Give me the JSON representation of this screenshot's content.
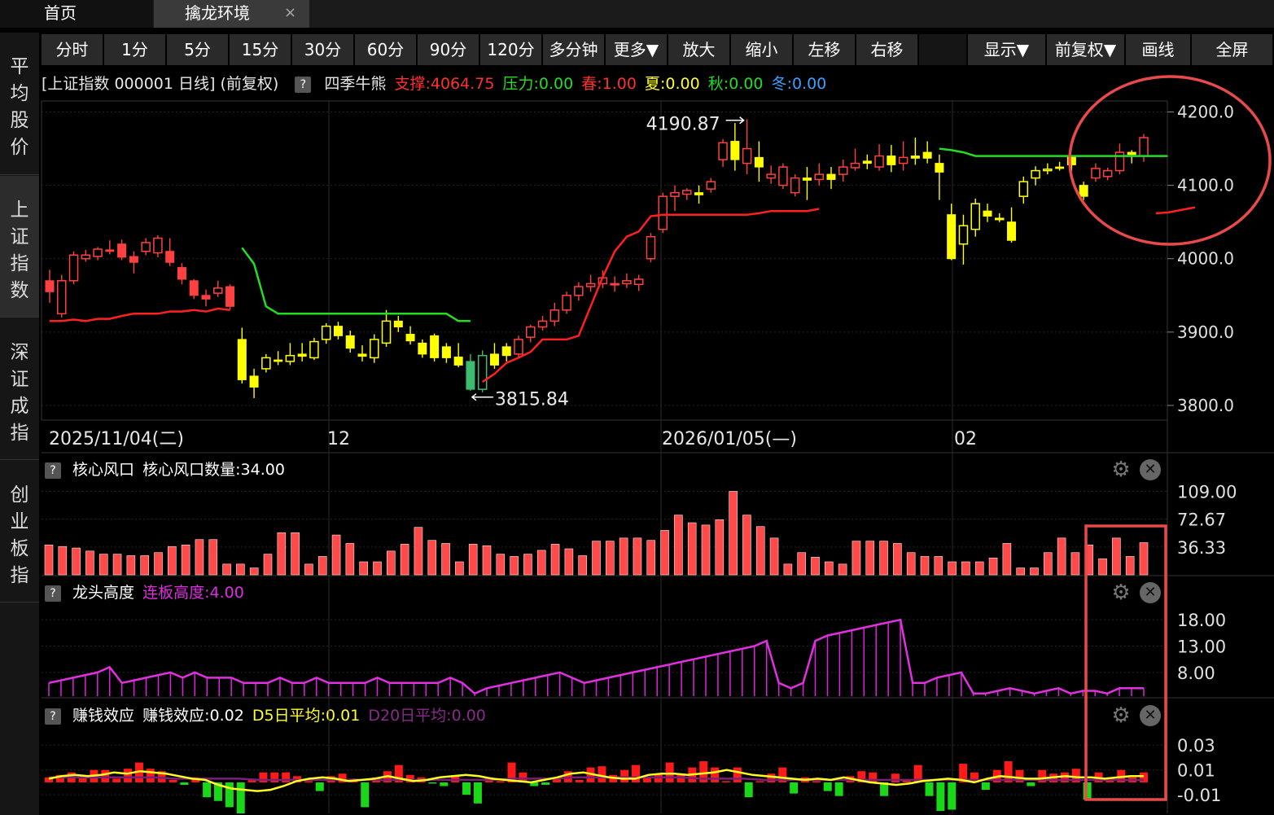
{
  "tabs": {
    "home": "首页",
    "active": "擒龙环境",
    "close": "×"
  },
  "sidebar": [
    {
      "label": "平均股价",
      "active": false
    },
    {
      "label": "上证指数",
      "active": true
    },
    {
      "label": "深证成指",
      "active": false
    },
    {
      "label": "创业板指",
      "active": false
    }
  ],
  "toolbar": [
    "分时",
    "1分",
    "5分",
    "15分",
    "30分",
    "60分",
    "90分",
    "120分",
    "多分钟",
    "更多▼",
    "放大",
    "缩小",
    "左移",
    "右移",
    "",
    "显示▼",
    "前复权▼",
    "画线",
    "全屏"
  ],
  "info": {
    "title": "[上证指数 000001 日线]  (前复权)",
    "help": "?",
    "indicator": "四季牛熊",
    "support": "支撑:4064.75",
    "pressure": "压力:0.00",
    "spring": "春:1.00",
    "summer": "夏:0.00",
    "autumn": "秋:0.00",
    "winter": "冬:0.00"
  },
  "main_axis": [
    "4200.0",
    "4100.0",
    "4000.0",
    "3900.0",
    "3800.0"
  ],
  "annotations": {
    "high": "4190.87",
    "low": "3815.84"
  },
  "date_axis": [
    "2025/11/04(二)",
    "12",
    "2026/01/05(—)",
    "02"
  ],
  "pane1": {
    "help": "?",
    "name": "核心风口",
    "value": "核心风口数量:34.00",
    "axis": [
      "109.00",
      "72.67",
      "36.33"
    ]
  },
  "pane2": {
    "help": "?",
    "name": "龙头高度",
    "value": "连板高度:4.00",
    "axis": [
      "18.00",
      "13.00",
      "8.00"
    ]
  },
  "pane3": {
    "help": "?",
    "name": "赚钱效应",
    "value": "赚钱效应:0.02",
    "d5": "D5日平均:0.01",
    "d20": "D20日平均:0.00",
    "axis": [
      "0.03",
      "0.01",
      "-0.01"
    ]
  },
  "colors": {
    "up": "#ff4040",
    "down_yellow": "#ffff00",
    "green": "#00dd00",
    "magenta": "#dd22dd",
    "annotation_red": "#e84a4a"
  },
  "chart_data": [
    {
      "type": "candlestick",
      "title": "上证指数 000001 日线",
      "y_ticks": [
        4200,
        4100,
        4000,
        3900,
        3800
      ],
      "ylim": [
        3780,
        4215
      ],
      "high_marker": 4190.87,
      "low_marker": 3815.84,
      "candles": [
        [
          3970,
          3955,
          3985,
          3940
        ],
        [
          3925,
          3970,
          3978,
          3920
        ],
        [
          3970,
          4005,
          4010,
          3965
        ],
        [
          4000,
          4005,
          4012,
          3996
        ],
        [
          4003,
          4013,
          4016,
          3998
        ],
        [
          4012,
          4010,
          4025,
          4006
        ],
        [
          4020,
          4002,
          4026,
          3998
        ],
        [
          4003,
          3995,
          4010,
          3980
        ],
        [
          4010,
          4022,
          4028,
          4005
        ],
        [
          4008,
          4028,
          4032,
          4002
        ],
        [
          4010,
          3995,
          4028,
          3990
        ],
        [
          3988,
          3972,
          3994,
          3965
        ],
        [
          3970,
          3950,
          3972,
          3945
        ],
        [
          3950,
          3945,
          3958,
          3935
        ],
        [
          3953,
          3960,
          3970,
          3948
        ],
        [
          3962,
          3935,
          3965,
          3930
        ],
        [
          3890,
          3835,
          3906,
          3830
        ],
        [
          3840,
          3825,
          3850,
          3810
        ],
        [
          3850,
          3865,
          3870,
          3845
        ],
        [
          3862,
          3860,
          3874,
          3855
        ],
        [
          3860,
          3868,
          3885,
          3855
        ],
        [
          3870,
          3867,
          3885,
          3860
        ],
        [
          3865,
          3887,
          3892,
          3862
        ],
        [
          3890,
          3908,
          3912,
          3884
        ],
        [
          3908,
          3895,
          3914,
          3890
        ],
        [
          3895,
          3878,
          3902,
          3872
        ],
        [
          3870,
          3867,
          3882,
          3860
        ],
        [
          3865,
          3890,
          3897,
          3858
        ],
        [
          3885,
          3915,
          3930,
          3880
        ],
        [
          3915,
          3907,
          3922,
          3900
        ],
        [
          3897,
          3888,
          3908,
          3883
        ],
        [
          3885,
          3870,
          3890,
          3865
        ],
        [
          3895,
          3865,
          3898,
          3860
        ],
        [
          3880,
          3865,
          3885,
          3858
        ],
        [
          3866,
          3855,
          3885,
          3852
        ],
        [
          3860,
          3822,
          3870,
          3820
        ],
        [
          3822,
          3868,
          3875,
          3818
        ],
        [
          3870,
          3855,
          3885,
          3850
        ],
        [
          3880,
          3868,
          3885,
          3860
        ],
        [
          3870,
          3890,
          3895,
          3866
        ],
        [
          3893,
          3907,
          3910,
          3886
        ],
        [
          3907,
          3915,
          3922,
          3902
        ],
        [
          3915,
          3930,
          3940,
          3908
        ],
        [
          3930,
          3950,
          3955,
          3925
        ],
        [
          3950,
          3962,
          3968,
          3943
        ],
        [
          3962,
          3966,
          3978,
          3955
        ],
        [
          3966,
          3974,
          3984,
          3960
        ],
        [
          3965,
          3966,
          3976,
          3955
        ],
        [
          3966,
          3970,
          3980,
          3960
        ],
        [
          3965,
          3972,
          3978,
          3956
        ],
        [
          4000,
          4030,
          4035,
          3995
        ],
        [
          4040,
          4085,
          4090,
          4035
        ],
        [
          4085,
          4090,
          4100,
          4065
        ],
        [
          4088,
          4093,
          4096,
          4080
        ],
        [
          4090,
          4087,
          4100,
          4075
        ],
        [
          4095,
          4105,
          4110,
          4090
        ],
        [
          4135,
          4158,
          4163,
          4125
        ],
        [
          4160,
          4135,
          4185,
          4120
        ],
        [
          4130,
          4150,
          4190,
          4115
        ],
        [
          4138,
          4125,
          4160,
          4105
        ],
        [
          4110,
          4115,
          4127,
          4102
        ],
        [
          4100,
          4125,
          4130,
          4095
        ],
        [
          4090,
          4110,
          4115,
          4085
        ],
        [
          4110,
          4107,
          4125,
          4080
        ],
        [
          4108,
          4115,
          4130,
          4100
        ],
        [
          4115,
          4108,
          4125,
          4095
        ],
        [
          4115,
          4125,
          4135,
          4105
        ],
        [
          4124,
          4130,
          4150,
          4120
        ],
        [
          4133,
          4130,
          4142,
          4122
        ],
        [
          4125,
          4140,
          4156,
          4120
        ],
        [
          4140,
          4128,
          4155,
          4118
        ],
        [
          4130,
          4138,
          4160,
          4120
        ],
        [
          4140,
          4137,
          4165,
          4128
        ],
        [
          4145,
          4137,
          4160,
          4130
        ],
        [
          4130,
          4118,
          4142,
          4080
        ],
        [
          4060,
          4000,
          4075,
          3998
        ],
        [
          4020,
          4045,
          4060,
          3992
        ],
        [
          4040,
          4075,
          4082,
          4030
        ],
        [
          4065,
          4058,
          4075,
          4050
        ],
        [
          4055,
          4055,
          4062,
          4050
        ],
        [
          4050,
          4025,
          4070,
          4022
        ],
        [
          4085,
          4105,
          4112,
          4075
        ],
        [
          4110,
          4120,
          4126,
          4100
        ],
        [
          4120,
          4122,
          4130,
          4115
        ],
        [
          4125,
          4123,
          4132,
          4120
        ],
        [
          4140,
          4128,
          4140,
          4120
        ],
        [
          4100,
          4085,
          4105,
          4080
        ],
        [
          4110,
          4123,
          4130,
          4105
        ],
        [
          4112,
          4120,
          4124,
          4107
        ],
        [
          4120,
          4145,
          4157,
          4115
        ],
        [
          4145,
          4142,
          4148,
          4130
        ],
        [
          4140,
          4165,
          4170,
          4132
        ]
      ],
      "support_line": [
        3915,
        3915,
        3917,
        3915,
        3918,
        3918,
        3922,
        3925,
        3925,
        3925,
        3928,
        3928,
        3930,
        3928,
        3932,
        3930
      ],
      "bear_line": [
        4015,
        3993,
        3935,
        3925,
        3925,
        3925,
        3925,
        3925,
        3925,
        3925,
        3925,
        3925,
        3925,
        3925,
        3925,
        3925,
        3925,
        3925,
        3915,
        3915
      ],
      "support_line2": [
        3832,
        3843,
        3858,
        3865,
        3873,
        3890,
        3890,
        3890,
        3895,
        3935,
        3975,
        4010,
        4030,
        4037,
        4058,
        4060,
        4060,
        4060,
        4060,
        4060,
        4060,
        4060,
        4060,
        4062,
        4065,
        4065,
        4065,
        4065,
        4068
      ],
      "resistance_line2": [
        4150,
        4148,
        4145,
        4140,
        4140,
        4140,
        4140,
        4140,
        4140,
        4140,
        4140,
        4140,
        4140,
        4140,
        4140,
        4140,
        4140,
        4140,
        4140,
        4140
      ]
    },
    {
      "type": "bar",
      "name": "核心风口数量",
      "ylim": [
        0,
        118
      ],
      "values": [
        39,
        37,
        35,
        31,
        27,
        27,
        25,
        25,
        29,
        37,
        39,
        46,
        46,
        14,
        14,
        9,
        27,
        55,
        55,
        14,
        24,
        52,
        41,
        17,
        17,
        31,
        40,
        62,
        45,
        41,
        17,
        40,
        38,
        27,
        24,
        27,
        32,
        40,
        34,
        25,
        44,
        44,
        48,
        48,
        45,
        58,
        78,
        68,
        65,
        72,
        109,
        78,
        63,
        48,
        14,
        29,
        23,
        17,
        14,
        44,
        44,
        44,
        41,
        29,
        24,
        24,
        17,
        17,
        17,
        22,
        41,
        9,
        9,
        29,
        48,
        29,
        39,
        21,
        48,
        24,
        42
      ],
      "last_value": 34.0
    },
    {
      "type": "area",
      "name": "连板高度",
      "ylim": [
        3.5,
        20.5
      ],
      "values": [
        6,
        6.5,
        7,
        7.5,
        8,
        9,
        6,
        6.5,
        7,
        7.5,
        8,
        7,
        8,
        7,
        7,
        7,
        6,
        6,
        6,
        7,
        6,
        6,
        7,
        6,
        6,
        6,
        6,
        7,
        6,
        6,
        6,
        6,
        6,
        7,
        6,
        4,
        5,
        5.5,
        6,
        6.5,
        7,
        7.5,
        8,
        7,
        6,
        6.5,
        7,
        7.5,
        8,
        8.5,
        9,
        9.5,
        10,
        10.5,
        11,
        11.5,
        12,
        12.5,
        13,
        14,
        6,
        5,
        6,
        14,
        15,
        15.5,
        16,
        16.5,
        17,
        17.5,
        18,
        6,
        6,
        7,
        7.5,
        8,
        4,
        4,
        4.5,
        5,
        4.5,
        4,
        4.5,
        5,
        4,
        4.5,
        4.5,
        4,
        5,
        5,
        5
      ],
      "last_value": 4.0
    },
    {
      "type": "bar",
      "name": "赚钱效应",
      "ylim": [
        -0.025,
        0.04
      ],
      "series": [
        {
          "name": "赚钱效应",
          "values": [
            0.004,
            0.006,
            0.008,
            0.005,
            0.01,
            0.01,
            0.003,
            0.011,
            0.016,
            0.011,
            0.009,
            0.002,
            -0.002,
            0.004,
            -0.012,
            -0.015,
            -0.02,
            -0.025,
            0.002,
            0.008,
            0.008,
            0.008,
            0.005,
            0.001,
            -0.007,
            0.005,
            0.007,
            0.003,
            -0.02,
            0.004,
            0.009,
            0.014,
            0.006,
            0.004,
            -0.001,
            -0.003,
            0.005,
            -0.01,
            -0.017,
            0.004,
            0.001,
            0.016,
            0.008,
            -0.003,
            -0.002,
            0.004,
            0.009,
            0.002,
            0.012,
            0.013,
            0.006,
            0.01,
            0.014,
            0.004,
            0.007,
            0.016,
            0.007,
            0.012,
            0.017,
            0.012,
            0.001,
            0.012,
            -0.012,
            0.001,
            0.007,
            0.012,
            -0.009,
            0.004,
            0.001,
            -0.007,
            -0.011,
            0.005,
            0.009,
            0.008,
            -0.011,
            0.007,
            0.002,
            0.014,
            -0.011,
            -0.023,
            -0.022,
            0.015,
            0.008,
            -0.006,
            0.01,
            0.017,
            0.01,
            -0.003,
            0.01,
            0.007,
            0.008,
            0.011,
            -0.014,
            0.008,
            0.004,
            0.01,
            0.004,
            0.008
          ]
        },
        {
          "name": "D5日平均",
          "values": [
            0.003,
            0.005,
            0.006,
            0.005,
            0.006,
            0.008,
            0.007,
            0.009,
            0.008,
            0.007,
            0.005,
            0.003,
            0.002,
            -0.002,
            -0.005,
            -0.006,
            -0.007,
            -0.006,
            -0.003,
            0.001,
            0.003,
            0.004,
            0.003,
            0.001,
            0.002,
            0.003,
            0.005,
            0.003,
            0.001,
            0.002,
            0.004,
            0.005,
            0.006,
            0.005,
            0.003,
            0.002,
            0.001,
            0.0,
            0.002,
            0.004,
            0.007,
            0.008,
            0.006,
            0.004,
            0.003,
            0.003,
            0.006,
            0.007,
            0.007,
            0.006,
            0.007,
            0.008,
            0.01,
            0.008,
            0.006,
            0.005,
            0.004,
            0.003,
            0.002,
            0.003,
            0.002,
            0.004,
            0.002,
            0.0,
            -0.001,
            -0.002,
            -0.001,
            0.001,
            0.002,
            0.003,
            0.002,
            0.0,
            0.003,
            0.005,
            0.004,
            0.003,
            0.003,
            0.004,
            0.005,
            0.004,
            0.004,
            0.003,
            0.004,
            0.005,
            0.005
          ]
        },
        {
          "name": "D20日平均",
          "values": [
            0.004,
            0.004,
            0.004,
            0.004,
            0.004,
            0.004,
            0.003,
            0.003,
            0.003,
            0.003,
            0.002,
            0.002,
            0.002,
            0.002,
            0.002,
            0.002,
            0.002,
            0.002,
            0.002,
            0.002,
            0.002,
            0.002,
            0.003,
            0.003,
            0.003,
            0.004,
            0.004,
            0.004,
            0.004,
            0.004,
            0.004,
            0.003,
            0.003,
            0.003,
            0.002,
            0.002,
            0.002,
            0.002,
            0.002,
            0.002,
            0.002,
            0.002,
            0.002,
            0.002,
            0.002,
            0.002,
            0.002,
            0.002,
            0.002,
            0.002,
            0.002,
            0.002,
            0.002
          ]
        }
      ],
      "last_value": 0.02
    }
  ]
}
